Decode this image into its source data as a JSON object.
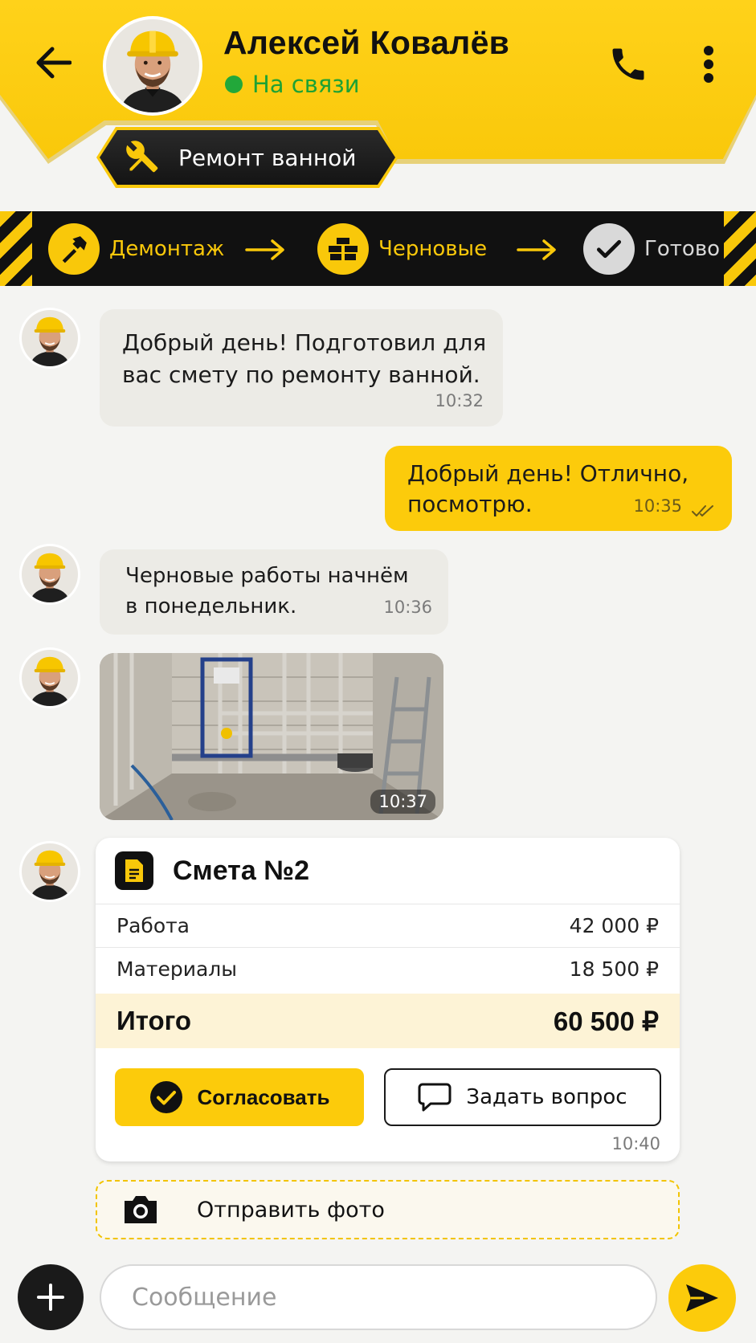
{
  "header": {
    "contact_name": "Алексей Ковалёв",
    "status": "На связи",
    "project_tag": "Ремонт ванной",
    "colors": {
      "accent": "#fccb0b",
      "dark": "#111111",
      "online": "#22a83a"
    }
  },
  "stages": [
    {
      "label": "Демонтаж",
      "icon": "hammer-icon",
      "state": "active"
    },
    {
      "label": "Черновые",
      "icon": "bricks-icon",
      "state": "active"
    },
    {
      "label": "Готово",
      "icon": "check-icon",
      "state": "pending"
    }
  ],
  "messages": [
    {
      "from": "contact",
      "text_lines": [
        "Добрый день! Подготовил для",
        "вас смету по ремонту ванной."
      ],
      "time": "10:32"
    },
    {
      "from": "me",
      "text_lines": [
        "Добрый день! Отлично,",
        "посмотрю."
      ],
      "time": "10:35"
    },
    {
      "from": "contact",
      "text_lines": [
        "Черновые работы начнём",
        "в понедельник."
      ],
      "time": "10:36"
    },
    {
      "from": "contact",
      "type": "photo",
      "time": "10:37"
    }
  ],
  "estimate": {
    "title": "Смета №2",
    "rows": [
      {
        "label": "Работа",
        "value": "42 000 ₽"
      },
      {
        "label": "Материалы",
        "value": "18 500 ₽"
      }
    ],
    "total_label": "Итого",
    "total_value": "60 500 ₽",
    "approve_label": "Согласовать",
    "ask_label": "Задать вопрос",
    "time": "10:40"
  },
  "send_photo_label": "Отправить фото",
  "composer": {
    "placeholder": "Сообщение"
  }
}
